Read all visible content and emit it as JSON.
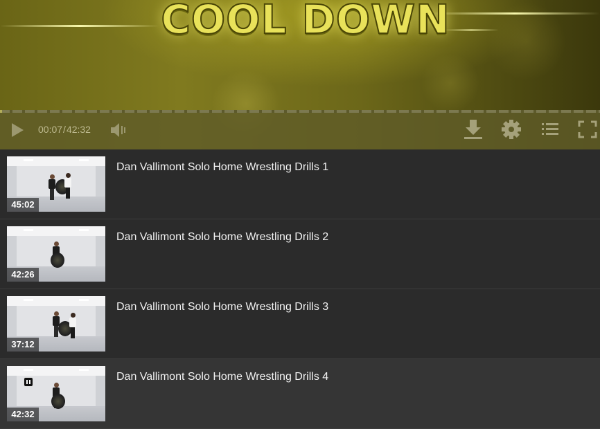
{
  "video": {
    "banner_text": "COOL DOWN",
    "current_time": "00:07",
    "total_time": "42:32",
    "progress_fraction": 0.003,
    "controls": {
      "play_icon": "play-icon",
      "volume_icon": "volume-icon",
      "download_icon": "download-icon",
      "settings_icon": "gear-icon",
      "playlist_icon": "playlist-icon",
      "fullscreen_icon": "fullscreen-icon"
    },
    "accent_color": "#e9e25a"
  },
  "playlist": {
    "items": [
      {
        "title": "Dan Vallimont Solo Home Wrestling Drills 1",
        "duration": "45:02",
        "active": false
      },
      {
        "title": "Dan Vallimont Solo Home Wrestling Drills 2",
        "duration": "42:26",
        "active": false
      },
      {
        "title": "Dan Vallimont Solo Home Wrestling Drills 3",
        "duration": "37:12",
        "active": false
      },
      {
        "title": "Dan Vallimont Solo Home Wrestling Drills 4",
        "duration": "42:32",
        "active": true
      }
    ]
  }
}
